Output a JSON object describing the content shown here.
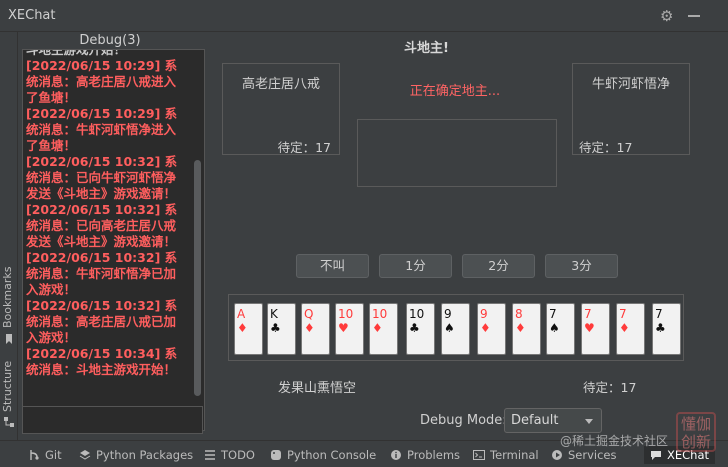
{
  "window": {
    "title": "XEChat"
  },
  "left_stripe": {
    "bookmarks": "Bookmarks",
    "structure": "Structure"
  },
  "debug_panel": {
    "title": "Debug(3)",
    "log_first_line": "斗地主游戏开始！",
    "log": "[2022/06/15 10:29] 系统消息：高老庄居八戒进入了鱼塘！\n[2022/06/15 10:29] 系统消息：牛虾河虾悟净进入了鱼塘！\n[2022/06/15 10:32] 系统消息：已向牛虾河虾悟净发送《斗地主》游戏邀请！\n[2022/06/15 10:32] 系统消息：已向高老庄居八戒发送《斗地主》游戏邀请！\n[2022/06/15 10:32] 系统消息：牛虾河虾悟净已加入游戏！\n[2022/06/15 10:32] 系统消息：高老庄居八戒已加入游戏！\n[2022/06/15 10:34] 系统消息：斗地主游戏开始！",
    "input_value": ""
  },
  "game": {
    "title": "斗地主!",
    "left_player": {
      "name": "高老庄居八戒",
      "status": "待定：17"
    },
    "right_player": {
      "name": "牛虾河虾悟净",
      "status": "待定：17"
    },
    "status_message": "正在确定地主...",
    "bid_buttons": [
      "不叫",
      "1分",
      "2分",
      "3分"
    ],
    "hand": [
      {
        "rank": "A",
        "suit": "♦",
        "color": "red"
      },
      {
        "rank": "K",
        "suit": "♣",
        "color": "black"
      },
      {
        "rank": "Q",
        "suit": "♦",
        "color": "red"
      },
      {
        "rank": "10",
        "suit": "♥",
        "color": "red"
      },
      {
        "rank": "10",
        "suit": "♦",
        "color": "red"
      },
      {
        "rank": "10",
        "suit": "♣",
        "color": "black"
      },
      {
        "rank": "9",
        "suit": "♠",
        "color": "black"
      },
      {
        "rank": "9",
        "suit": "♦",
        "color": "red"
      },
      {
        "rank": "8",
        "suit": "♦",
        "color": "red"
      },
      {
        "rank": "7",
        "suit": "♠",
        "color": "black"
      },
      {
        "rank": "7",
        "suit": "♥",
        "color": "red"
      },
      {
        "rank": "7",
        "suit": "♦",
        "color": "red"
      },
      {
        "rank": "7",
        "suit": "♣",
        "color": "black"
      }
    ],
    "me": {
      "name": "发果山熏悟空",
      "status": "待定：17"
    }
  },
  "debug_mode": {
    "label": "Debug Mode:",
    "value": "Default"
  },
  "bottom_tabs": [
    {
      "label": "Git",
      "icon": "branch-icon"
    },
    {
      "label": "Python Packages",
      "icon": "layers-icon"
    },
    {
      "label": "TODO",
      "icon": "list-icon"
    },
    {
      "label": "Python Console",
      "icon": "python-icon"
    },
    {
      "label": "Problems",
      "icon": "info-icon"
    },
    {
      "label": "Terminal",
      "icon": "terminal-icon"
    },
    {
      "label": "Services",
      "icon": "play-icon"
    },
    {
      "label": "XEChat",
      "icon": "chat-icon"
    }
  ],
  "watermark": {
    "text": "@稀土掘金技术社区",
    "stamp": "懂伽\n创新"
  }
}
